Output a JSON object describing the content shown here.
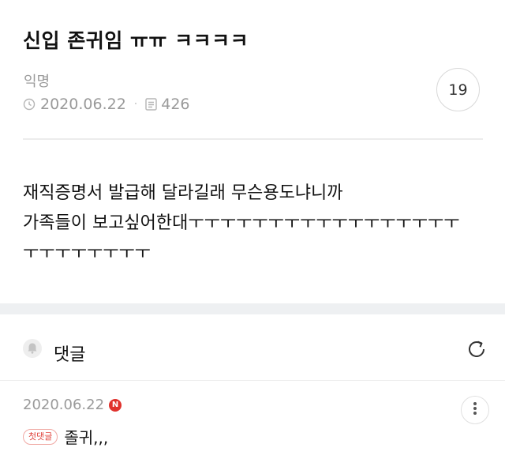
{
  "post": {
    "title": "신입 존귀임 ㅠㅠ ㅋㅋㅋㅋ",
    "author": "익명",
    "date": "2020.06.22",
    "views": "426",
    "comment_count": "19",
    "body_lines": [
      "재직증명서 발급해 달라길래 무슨용도냐니까",
      "가족들이 보고싶어한대ㅜㅜㅜㅜㅜㅜㅜㅜㅜㅜㅜㅜㅜㅜㅜㅜㅜ",
      "ㅜㅜㅜㅜㅜㅜㅜㅜ"
    ]
  },
  "comments": {
    "header_label": "댓글",
    "items": [
      {
        "date": "2020.06.22",
        "new_badge": "N",
        "first_badge": "첫댓글",
        "text": "졸귀,,,"
      }
    ]
  },
  "colors": {
    "text": "#111111",
    "muted": "#9a9a9a",
    "badge_red": "#e0322d",
    "section_gap": "#eef0f2"
  },
  "icons": [
    "clock-icon",
    "views-icon",
    "bell-icon",
    "refresh-icon",
    "more-vertical-icon"
  ]
}
